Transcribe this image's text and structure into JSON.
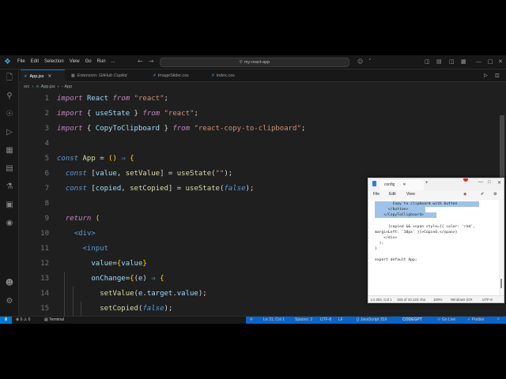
{
  "titlebar": {
    "menu": [
      "File",
      "Edit",
      "Selection",
      "View",
      "Go",
      "Run",
      "..."
    ],
    "search_text": "my-react-app"
  },
  "tabs": [
    {
      "label": "App.jsx",
      "icon": "jsx",
      "active": true
    },
    {
      "label": "Extension: GitHub Copilot",
      "icon": "extension",
      "active": false
    },
    {
      "label": "ImageSlider.css",
      "icon": "css",
      "active": false
    },
    {
      "label": "index.css",
      "icon": "css",
      "active": false
    }
  ],
  "breadcrumb": [
    "src",
    "App.jsx",
    "App"
  ],
  "code": {
    "line_numbers": [
      "1",
      "2",
      "3",
      "4",
      "5",
      "6",
      "7",
      "8",
      "9",
      "10",
      "11",
      "12",
      "13",
      "14",
      "15"
    ]
  },
  "statusbar": {
    "problems": "0 ⚠ 0",
    "terminal": "Terminal",
    "position": "Ln 31, Col 1",
    "spaces": "Spaces: 2",
    "encoding": "UTF-8",
    "eol": "LF",
    "language": "{} JavaScript JSX",
    "codegpt": "CODEGPT",
    "golive": "Go Live",
    "prettier": "Prettier"
  },
  "notepad": {
    "tab_title": "config",
    "menu": [
      "File",
      "Edit",
      "View"
    ],
    "lines": [
      "        Copy to clipboard with button",
      "      </button>",
      "    </CopyToClipboard>",
      "",
      "      {copied && <span style={{ color: 'red',",
      "marginLeft: '10px' }}>Copied.</span>}",
      "    </div>",
      "  );",
      "}",
      "",
      "export default App;"
    ],
    "status": {
      "position": "Ln 304, Col 1",
      "chars": "163 of 10,122 cha",
      "zoom": "100%",
      "eol": "Windows (CR",
      "encoding": "UTF-8"
    }
  },
  "colors": {
    "accent": "#0078d4",
    "editor_bg": "#1f1f1f",
    "keyword": "#c586c0",
    "string": "#ce9178"
  }
}
